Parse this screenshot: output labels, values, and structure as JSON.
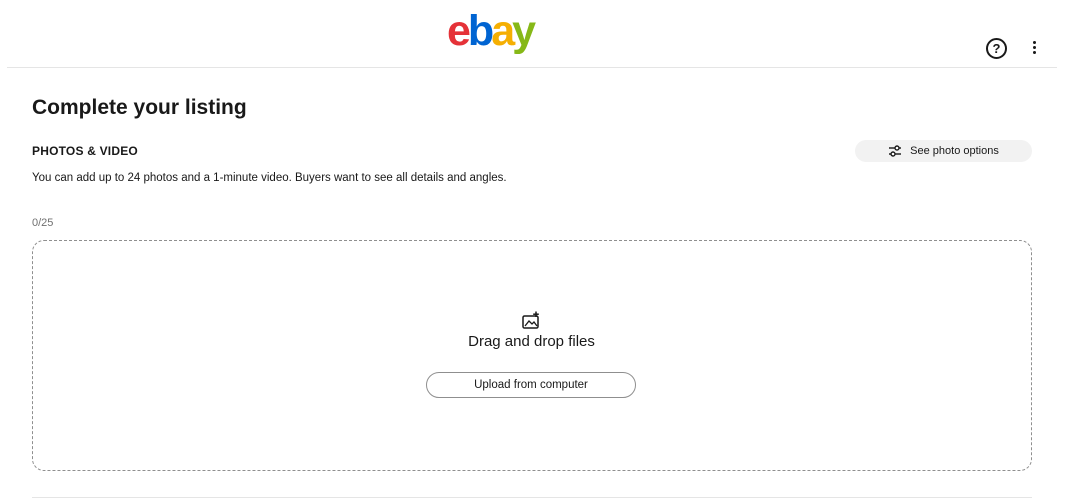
{
  "header": {
    "logo": {
      "e": "e",
      "b": "b",
      "a": "a",
      "y": "y"
    },
    "help_label": "?",
    "brand_colors": {
      "e": "#e53238",
      "b": "#0064d2",
      "a": "#f5af02",
      "y": "#86b817"
    }
  },
  "page": {
    "title": "Complete your listing"
  },
  "photos_section": {
    "title": "PHOTOS & VIDEO",
    "options_label": "See photo options",
    "description": "You can add up to 24 photos and a 1-minute video. Buyers want to see all details and angles.",
    "counter": "0/25",
    "dropzone_title": "Drag and drop files",
    "upload_label": "Upload from computer"
  },
  "icons": {
    "help": "question-circle-icon",
    "more": "vertical-ellipsis-icon",
    "options": "sliders-icon",
    "dropzone": "image-upload-icon"
  }
}
